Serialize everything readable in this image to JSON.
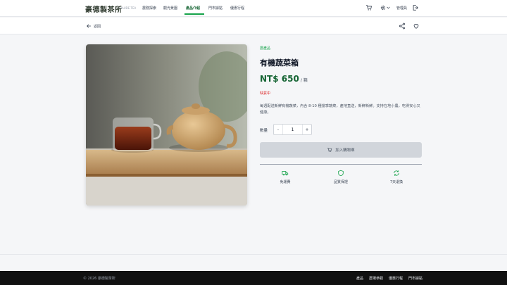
{
  "header": {
    "brand": "豪德製茶所",
    "brand_sub": "HAUDE TEA",
    "nav": [
      "農務探索",
      "觀光景園",
      "產品介紹",
      "門市據點",
      "優惠行程"
    ],
    "active_nav": "產品介紹",
    "admin_label": "管理員"
  },
  "subbar": {
    "back_label": "返回"
  },
  "product": {
    "category": "農產品",
    "name": "有機蔬菜箱",
    "price": "NT$ 650",
    "unit": "/ 箱",
    "stock_status": "缺貨中",
    "description": "每週配送新鮮有機蔬菜，內含 8-10 種當季蔬菜，產地直送，新鮮新鮮。支持在地小農，吃得安心又健康。",
    "quantity_label": "數量",
    "quantity": "1",
    "decrement": "-",
    "increment": "+",
    "add_to_cart": "加入購物車"
  },
  "features": [
    {
      "icon": "truck-icon",
      "label": "免運費"
    },
    {
      "icon": "shield-icon",
      "label": "品質保證"
    },
    {
      "icon": "refresh-icon",
      "label": "7天退換"
    }
  ],
  "footer": {
    "copyright": "© 2026 豪德製茶所",
    "links": [
      "產品",
      "農場參觀",
      "優惠行程",
      "門市據點"
    ]
  },
  "colors": {
    "accent": "#16a34a",
    "price": "#166534",
    "stock": "#dc2626",
    "footer_bg": "#111111"
  }
}
